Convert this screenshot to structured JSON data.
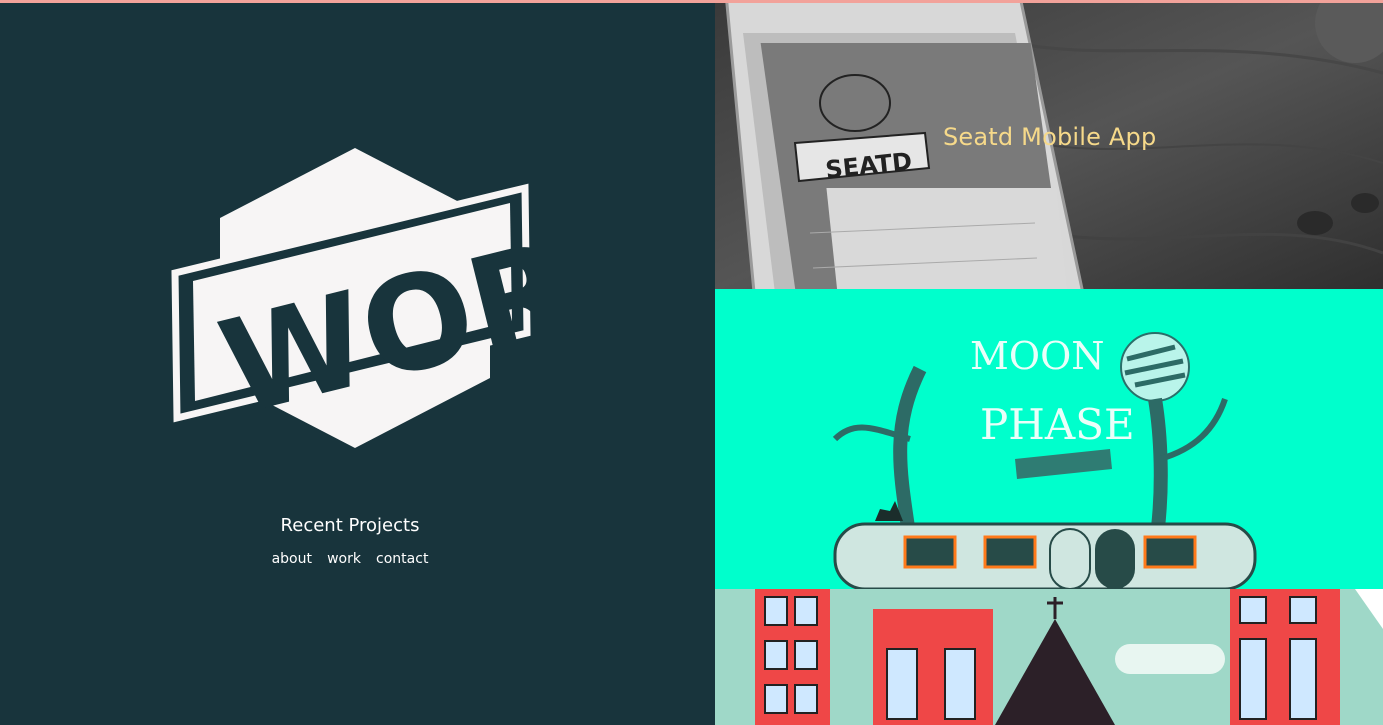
{
  "page": {
    "section_title": "Recent Projects",
    "logo_text": "WORK"
  },
  "nav": {
    "items": [
      {
        "label": "about"
      },
      {
        "label": "work"
      },
      {
        "label": "contact"
      }
    ]
  },
  "projects": [
    {
      "title": "Seatd Mobile App",
      "image": "seatd-phone-photo"
    },
    {
      "title": "",
      "image": "moon-phase-illustration"
    },
    {
      "title": "",
      "image": "city-buildings-illustration"
    }
  ],
  "colors": {
    "background": "#18343c",
    "accent_title": "#f6d98a",
    "mint": "#00ffcc",
    "top_line": "#f2a29a"
  }
}
